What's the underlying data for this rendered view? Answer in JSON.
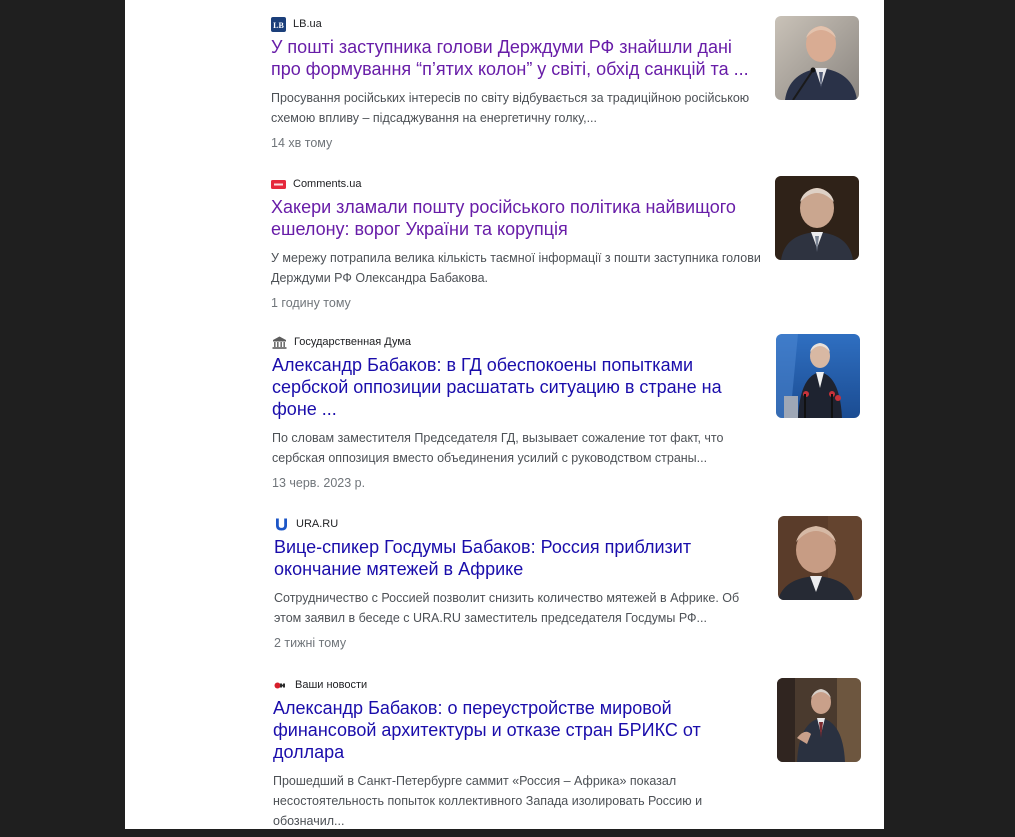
{
  "articles": [
    {
      "source": "LB.ua",
      "icon": "lb-ua-logo-icon",
      "headline": "У пошті заступника голови Держдуми РФ знайшли дані про формування “п’ятих колон” у світі, обхід санкцій та ...",
      "snippet": "Просування російських інтересів по світу відбувається за традиційною російською схемою впливу – підсаджування на енергетичну голку,...",
      "time": "14 хв тому",
      "thumb": "portrait-man-microphone-photo"
    },
    {
      "source": "Comments.ua",
      "icon": "comments-ua-logo-icon",
      "headline": "Хакери зламали пошту російського політика найвищого ешелону: ворог України та корупція",
      "snippet": "У мережу потрапила велика кількість таємної інформації з пошти заступника голови Держдуми РФ Олександра Бабакова.",
      "time": "1 годину тому",
      "thumb": "portrait-man-dark-background-photo"
    },
    {
      "source": "Государственная Дума",
      "icon": "duma-building-icon",
      "headline": "Александр Бабаков: в ГД обеспокоены попытками сербской оппозиции расшатать ситуацию в стране на фоне ...",
      "snippet": "По словам заместителя Председателя ГД, вызывает сожаление тот факт, что сербская оппозиция вместо объединения усилий с руководством страны...",
      "time": "13 черв. 2023 р.",
      "thumb": "man-at-podium-microphones-photo"
    },
    {
      "source": "URA.RU",
      "icon": "ura-ru-logo-icon",
      "headline": "Вице-спикер Госдумы Бабаков: Россия приблизит окончание мятежей в Африке",
      "snippet": "Сотрудничество с Россией позволит снизить количество мятежей в Африке. Об этом заявил в беседе с URA.RU заместитель председателя Госдумы РФ...",
      "time": "2 тижні тому",
      "thumb": "portrait-man-closeup-photo"
    },
    {
      "source": "Ваши новости",
      "icon": "vashi-novosti-logo-icon",
      "headline": "Александр Бабаков: о переустройстве мировой финансовой архитектуры и отказе стран БРИКС от доллара",
      "snippet": "Прошедший в Санкт-Петербурге саммит «Россия – Африка» показал несостоятельность попыток коллективного Запада изолировать Россию и обозначил...",
      "time": "",
      "thumb": "man-speaking-seated-photo"
    }
  ],
  "colors": {
    "link": "#1a0dab",
    "visited": "#681da8",
    "snippet": "#4d5156",
    "time": "#70757a",
    "frame": "#1f1f1f",
    "page": "#ffffff"
  }
}
